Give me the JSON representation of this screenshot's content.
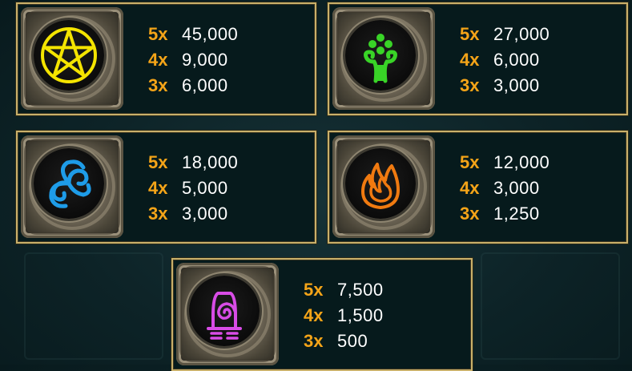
{
  "symbols": [
    {
      "icon": "pentagram-icon",
      "color": "#f4e400",
      "pays": [
        {
          "mult": "5x",
          "amount": "45,000"
        },
        {
          "mult": "4x",
          "amount": "9,000"
        },
        {
          "mult": "3x",
          "amount": "6,000"
        }
      ]
    },
    {
      "icon": "tree-icon",
      "color": "#39d427",
      "pays": [
        {
          "mult": "5x",
          "amount": "27,000"
        },
        {
          "mult": "4x",
          "amount": "6,000"
        },
        {
          "mult": "3x",
          "amount": "3,000"
        }
      ]
    },
    {
      "icon": "air-swirl-icon",
      "color": "#1e9ce8",
      "pays": [
        {
          "mult": "5x",
          "amount": "18,000"
        },
        {
          "mult": "4x",
          "amount": "5,000"
        },
        {
          "mult": "3x",
          "amount": "3,000"
        }
      ]
    },
    {
      "icon": "fire-icon",
      "color": "#f07a10",
      "pays": [
        {
          "mult": "5x",
          "amount": "12,000"
        },
        {
          "mult": "4x",
          "amount": "3,000"
        },
        {
          "mult": "3x",
          "amount": "1,250"
        }
      ]
    },
    {
      "icon": "earth-icon",
      "color": "#d84ce6",
      "pays": [
        {
          "mult": "5x",
          "amount": "7,500"
        },
        {
          "mult": "4x",
          "amount": "1,500"
        },
        {
          "mult": "3x",
          "amount": "500"
        }
      ]
    }
  ],
  "colors": {
    "multiplier": "#f4a418",
    "amount": "#ffffff",
    "border": "#c9b06a"
  }
}
